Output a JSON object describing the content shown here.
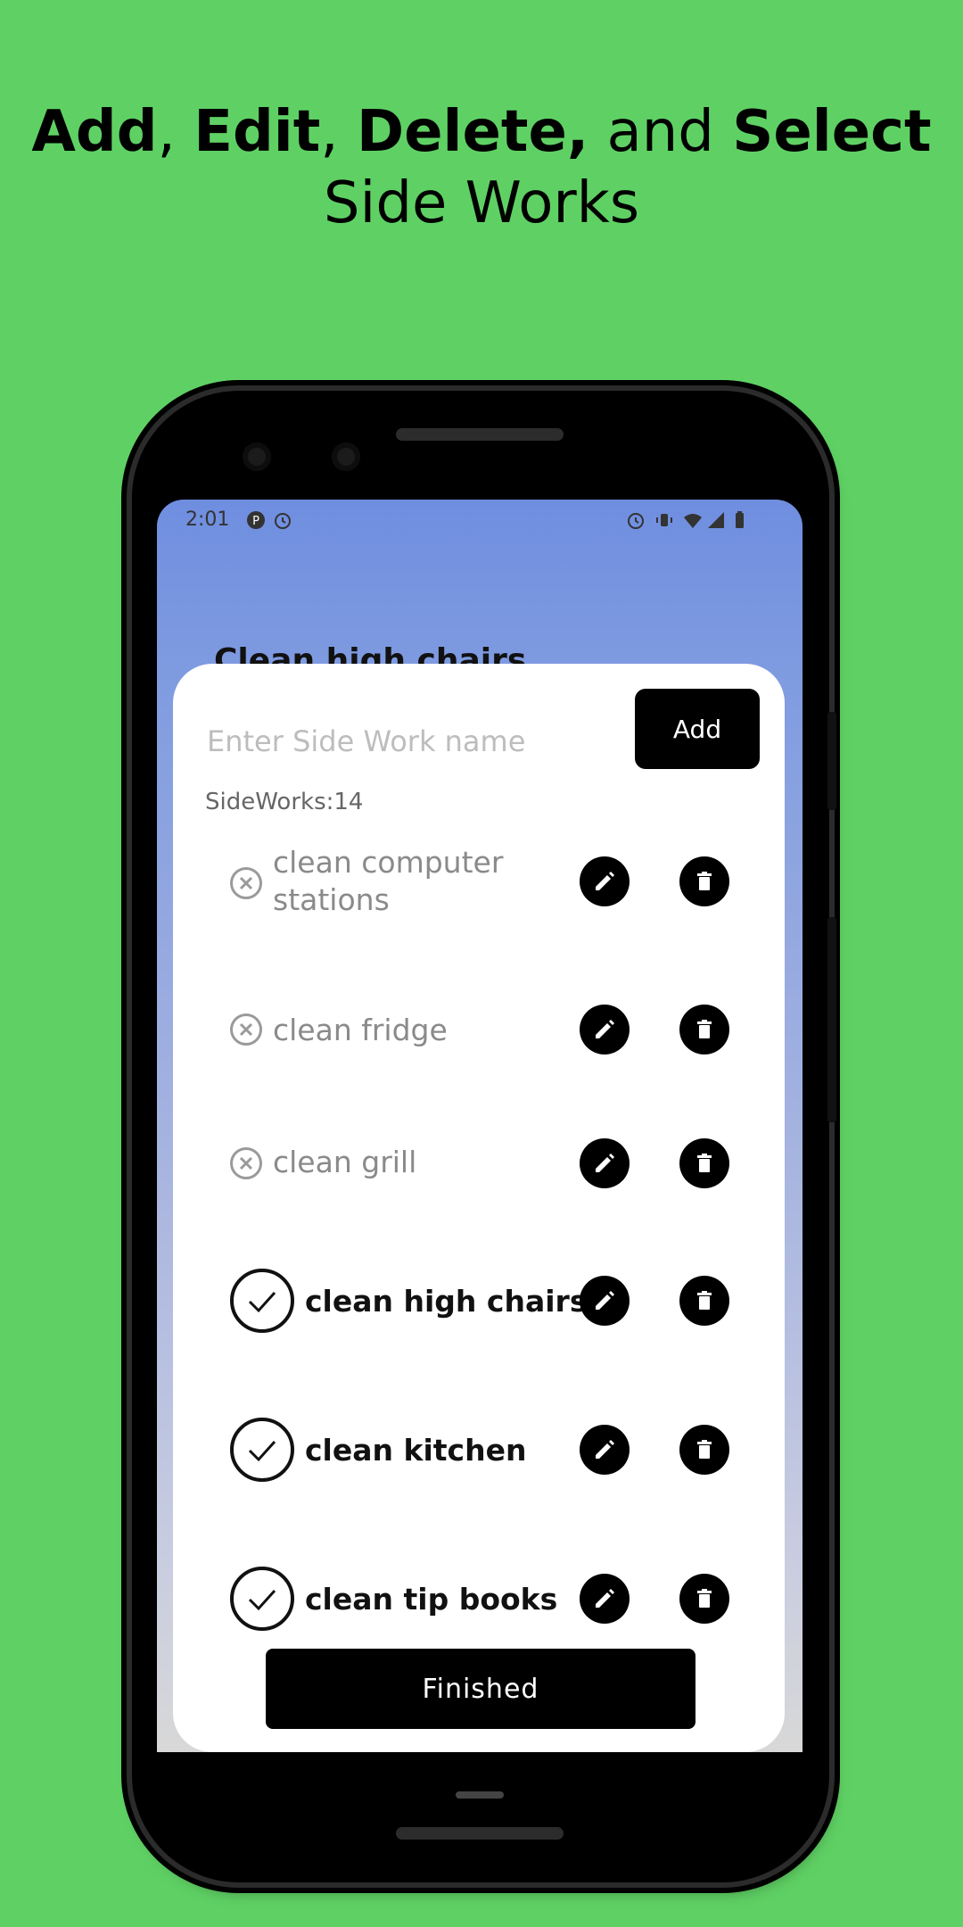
{
  "headline": {
    "line1_part1": "Add",
    "sep1": ", ",
    "line1_part2": "Edit",
    "sep2": ", ",
    "line1_part3": "Delete,",
    "sep3": " and ",
    "line1_part4": "Select",
    "line2": "Side Works"
  },
  "statusbar": {
    "time": "2:01"
  },
  "background_title": "Clean high chairs",
  "dialog": {
    "input_placeholder": "Enter Side Work name",
    "input_value": "",
    "add_label": "Add",
    "count_label": "SideWorks:14",
    "finished_label": "Finished"
  },
  "sideworks": [
    {
      "name": "clean computer stations",
      "line1": "clean computer",
      "line2": "stations",
      "selected": false
    },
    {
      "name": "clean fridge",
      "selected": false
    },
    {
      "name": "clean grill",
      "selected": false
    },
    {
      "name": "clean high chairs",
      "selected": true
    },
    {
      "name": "clean kitchen",
      "selected": true
    },
    {
      "name": "clean tip books",
      "selected": true
    }
  ],
  "colors": {
    "background": "#5fd164",
    "screen_gradient_top": "#6f8ee0",
    "button": "#000000",
    "inactive_text": "#8a8a8a"
  },
  "icons": {
    "unselected": "x-circle-icon",
    "selected": "check-circle-icon",
    "edit": "pencil-icon",
    "delete": "trash-icon"
  }
}
